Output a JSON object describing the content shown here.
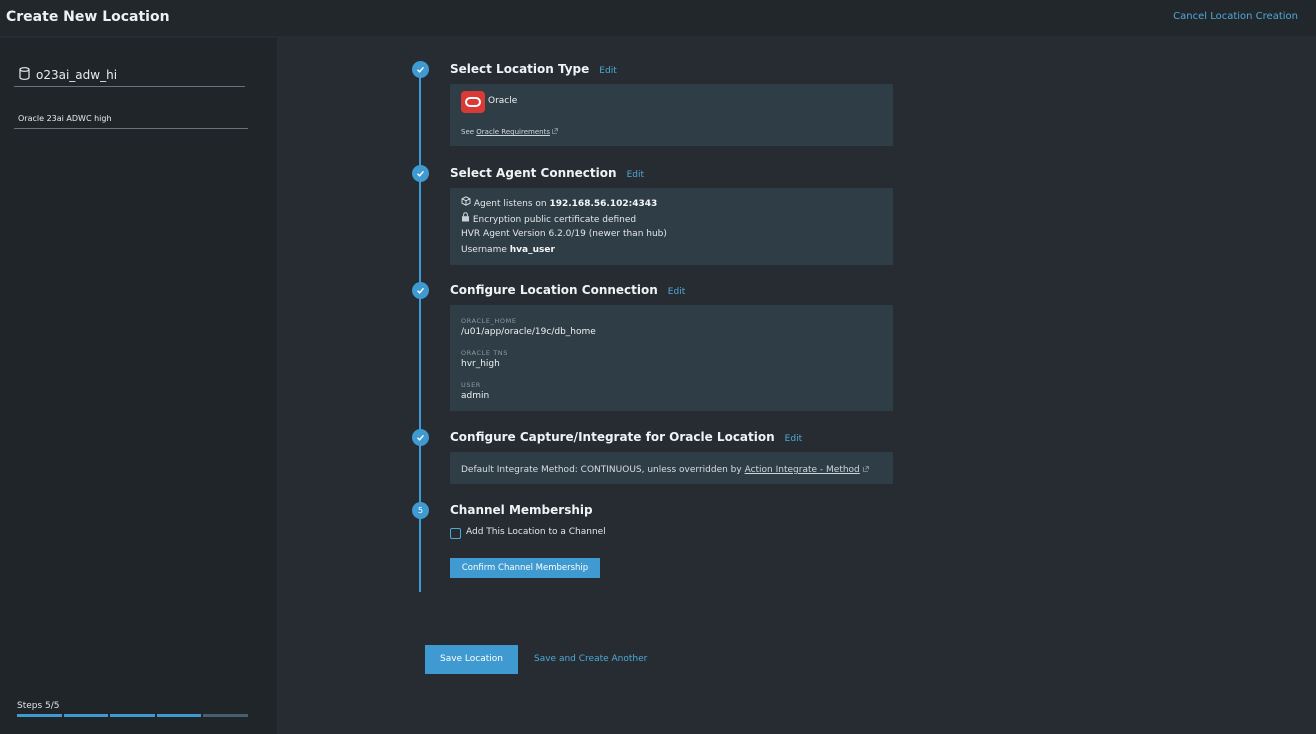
{
  "header": {
    "title": "Create New Location",
    "cancel_label": "Cancel Location Creation"
  },
  "sidebar": {
    "location_name": "o23ai_adw_hi",
    "description": "Oracle 23ai ADWC high",
    "steps_label": "Steps 5/5",
    "steps_total": 5,
    "steps_completed": 4
  },
  "steps": [
    {
      "number": "1",
      "title": "Select Location Type",
      "edit_label": "Edit",
      "completed": true
    },
    {
      "number": "2",
      "title": "Select Agent Connection",
      "edit_label": "Edit",
      "completed": true
    },
    {
      "number": "3",
      "title": "Configure Location Connection",
      "edit_label": "Edit",
      "completed": true
    },
    {
      "number": "4",
      "title": "Configure Capture/Integrate for Oracle Location",
      "edit_label": "Edit",
      "completed": true
    },
    {
      "number": "5",
      "title": "Channel Membership",
      "completed": false
    }
  ],
  "location_type": {
    "name": "Oracle",
    "see_prefix": "See ",
    "requirements_link": "Oracle Requirements"
  },
  "agent": {
    "listens_prefix": "Agent listens on ",
    "address": "192.168.56.102:4343",
    "certificate": "Encryption public certificate defined",
    "version": "HVR Agent Version 6.2.0/19 (newer than hub)",
    "username_prefix": "Username ",
    "username": "hva_user"
  },
  "connection": {
    "fields": [
      {
        "key": "ORACLE_HOME",
        "value": "/u01/app/oracle/19c/db_home"
      },
      {
        "key": "ORACLE TNS",
        "value": "hvr_high"
      },
      {
        "key": "USER",
        "value": "admin"
      }
    ]
  },
  "integrate": {
    "text": "Default Integrate Method: CONTINUOUS, unless overridden by ",
    "link": "Action Integrate - Method"
  },
  "membership": {
    "checkbox_label": "Add This Location to a Channel",
    "checked": false,
    "confirm_label": "Confirm Channel Membership"
  },
  "footer": {
    "save_label": "Save Location",
    "save_another_label": "Save and Create Another"
  },
  "colors": {
    "accent": "#3e9ad1",
    "link": "#4fa9d9",
    "oracle_red": "#d93a35",
    "card_bg": "#2f3d46",
    "progress_done": "#3e9ad1",
    "progress_pending": "#46606f"
  }
}
